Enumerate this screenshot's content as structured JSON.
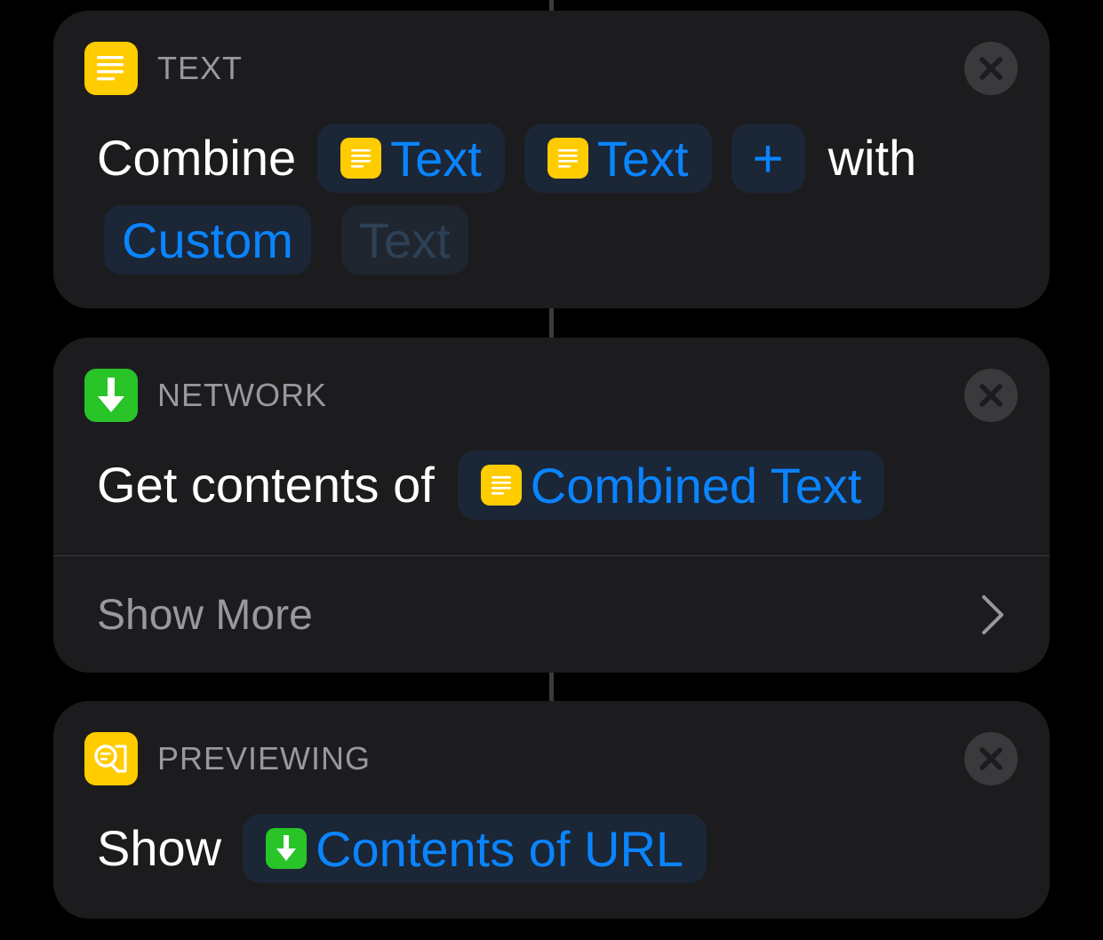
{
  "cards": {
    "text": {
      "category": "TEXT",
      "verb": "Combine",
      "token1": "Text",
      "token2": "Text",
      "add_symbol": "+",
      "with": "with",
      "separator": "Custom",
      "placeholder": "Text"
    },
    "network": {
      "category": "NETWORK",
      "verb": "Get contents of",
      "token": "Combined Text",
      "show_more": "Show More"
    },
    "previewing": {
      "category": "PREVIEWING",
      "verb": "Show",
      "token": "Contents of URL"
    }
  },
  "colors": {
    "accent": "#0a84ff",
    "text_icon": "#ffcc00",
    "network_icon": "#28c428",
    "card_bg": "#1c1c1e"
  },
  "icons": {
    "text": "text-lines-icon",
    "network": "download-arrow-icon",
    "previewing": "preview-eye-icon",
    "close": "close-icon",
    "chevron": "chevron-right-icon"
  }
}
